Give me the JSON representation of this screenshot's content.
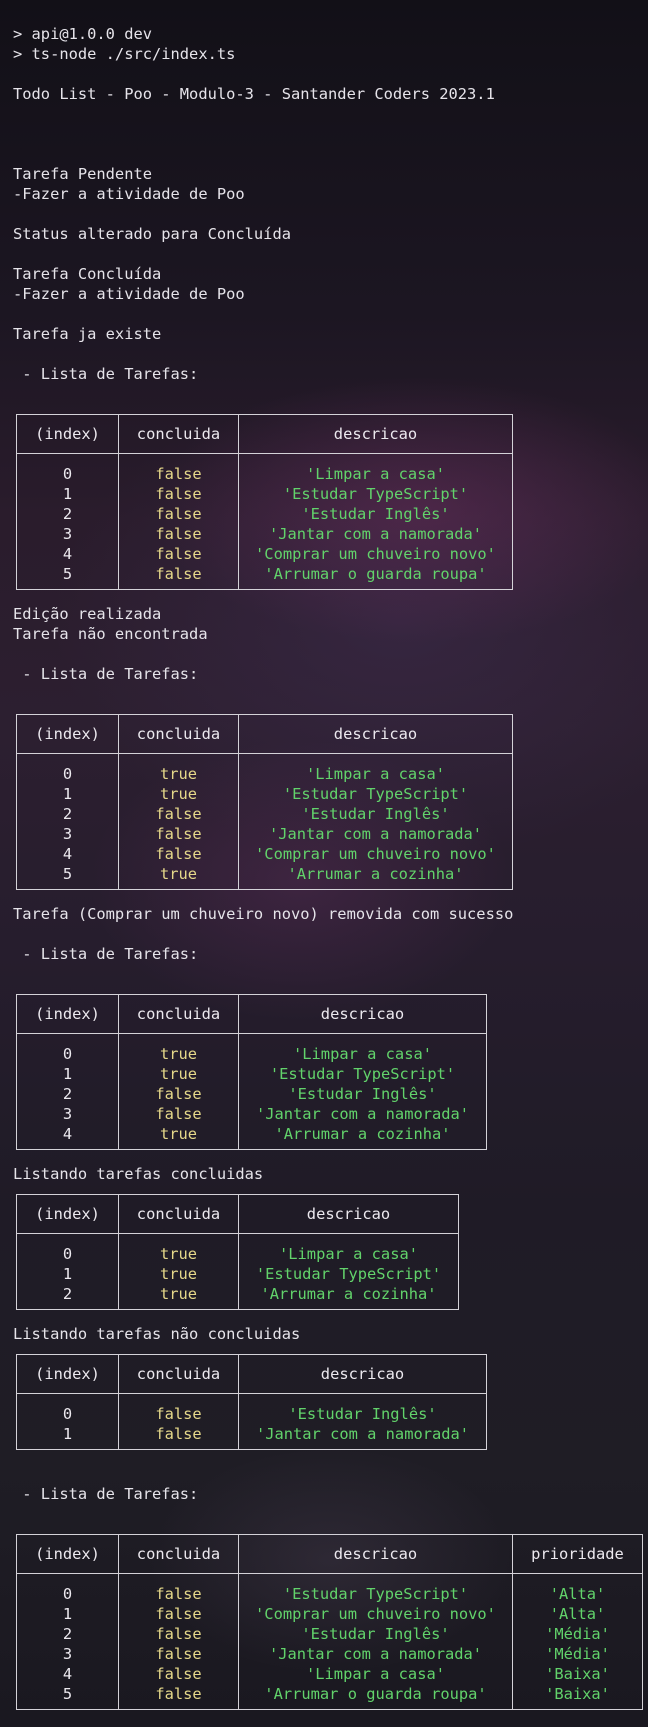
{
  "terminal": {
    "cmd_line_1": "> api@1.0.0 dev",
    "cmd_line_2": "> ts-node ./src/index.ts",
    "app_title": "Todo List - Poo - Modulo-3 - Santander Coders 2023.1",
    "msg_pendente": "Tarefa Pendente",
    "msg_pendente_item": "-Fazer a atividade de Poo",
    "msg_status": "Status alterado para Concluída",
    "msg_concluida": "Tarefa Concluída",
    "msg_concluida_item": "-Fazer a atividade de Poo",
    "msg_ja_existe": "Tarefa ja existe",
    "lista_header_1": " - Lista de Tarefas:",
    "msg_edicao": "Edição realizada",
    "msg_nao_encontrada": "Tarefa não encontrada",
    "lista_header_2": " - Lista de Tarefas:",
    "msg_removida": "Tarefa (Comprar um chuveiro novo) removida com sucesso",
    "lista_header_3": " - Lista de Tarefas:",
    "msg_listando_concluidas": "Listando tarefas concluidas",
    "msg_listando_nao_concluidas": "Listando tarefas não concluidas",
    "lista_header_4": " - Lista de Tarefas:"
  },
  "colors": {
    "index": "#ece9ef",
    "boolean": "#e6d98a",
    "string": "#62d36b",
    "border": "#d4d2d8"
  },
  "tables": [
    {
      "headers": [
        "(index)",
        "concluida",
        "descricao"
      ],
      "rows": [
        [
          "0",
          "false",
          "'Limpar a casa'"
        ],
        [
          "1",
          "false",
          "'Estudar TypeScript'"
        ],
        [
          "2",
          "false",
          "'Estudar Inglês'"
        ],
        [
          "3",
          "false",
          "'Jantar com a namorada'"
        ],
        [
          "4",
          "false",
          "'Comprar um chuveiro novo'"
        ],
        [
          "5",
          "false",
          "'Arrumar o guarda roupa'"
        ]
      ]
    },
    {
      "headers": [
        "(index)",
        "concluida",
        "descricao"
      ],
      "rows": [
        [
          "0",
          "true",
          "'Limpar a casa'"
        ],
        [
          "1",
          "true",
          "'Estudar TypeScript'"
        ],
        [
          "2",
          "false",
          "'Estudar Inglês'"
        ],
        [
          "3",
          "false",
          "'Jantar com a namorada'"
        ],
        [
          "4",
          "false",
          "'Comprar um chuveiro novo'"
        ],
        [
          "5",
          "true",
          "'Arrumar a cozinha'"
        ]
      ]
    },
    {
      "headers": [
        "(index)",
        "concluida",
        "descricao"
      ],
      "rows": [
        [
          "0",
          "true",
          "'Limpar a casa'"
        ],
        [
          "1",
          "true",
          "'Estudar TypeScript'"
        ],
        [
          "2",
          "false",
          "'Estudar Inglês'"
        ],
        [
          "3",
          "false",
          "'Jantar com a namorada'"
        ],
        [
          "4",
          "true",
          "'Arrumar a cozinha'"
        ]
      ]
    },
    {
      "headers": [
        "(index)",
        "concluida",
        "descricao"
      ],
      "rows": [
        [
          "0",
          "true",
          "'Limpar a casa'"
        ],
        [
          "1",
          "true",
          "'Estudar TypeScript'"
        ],
        [
          "2",
          "true",
          "'Arrumar a cozinha'"
        ]
      ]
    },
    {
      "headers": [
        "(index)",
        "concluida",
        "descricao"
      ],
      "rows": [
        [
          "0",
          "false",
          "'Estudar Inglês'"
        ],
        [
          "1",
          "false",
          "'Jantar com a namorada'"
        ]
      ]
    },
    {
      "headers": [
        "(index)",
        "concluida",
        "descricao",
        "prioridade"
      ],
      "rows": [
        [
          "0",
          "false",
          "'Estudar TypeScript'",
          "'Alta'"
        ],
        [
          "1",
          "false",
          "'Comprar um chuveiro novo'",
          "'Alta'"
        ],
        [
          "2",
          "false",
          "'Estudar Inglês'",
          "'Média'"
        ],
        [
          "3",
          "false",
          "'Jantar com a namorada'",
          "'Média'"
        ],
        [
          "4",
          "false",
          "'Limpar a casa'",
          "'Baixa'"
        ],
        [
          "5",
          "false",
          "'Arrumar o guarda roupa'",
          "'Baixa'"
        ]
      ]
    }
  ]
}
